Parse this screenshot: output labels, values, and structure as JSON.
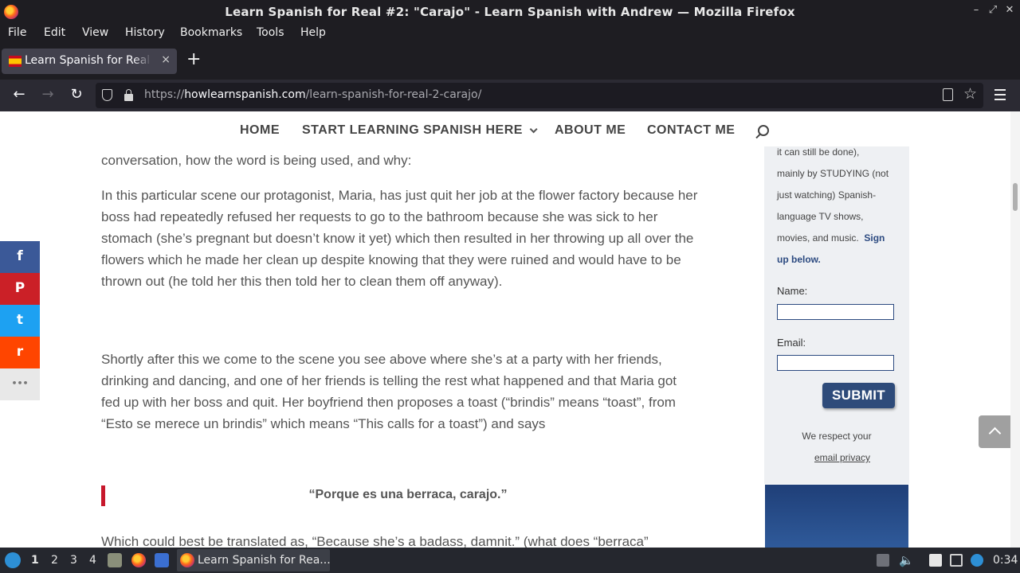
{
  "window": {
    "title": "Learn Spanish for Real #2: \"Carajo\" - Learn Spanish with Andrew — Mozilla Firefox"
  },
  "menu": [
    "File",
    "Edit",
    "View",
    "History",
    "Bookmarks",
    "Tools",
    "Help"
  ],
  "tab": {
    "title": "Learn Spanish for Real #2: \"Carajo\"",
    "close": "×",
    "new": "+"
  },
  "nav": {
    "url_prefix": "https://",
    "url_domain": "howlearnspanish.com",
    "url_path": "/learn-spanish-for-real-2-carajo/"
  },
  "site_nav": {
    "home": "HOME",
    "start": "START LEARNING SPANISH HERE",
    "about": "ABOUT ME",
    "contact": "CONTACT ME"
  },
  "article": {
    "p0": "conversation, how the word is being used, and why:",
    "p1": "In this particular scene our protagonist, Maria, has just quit her job at the flower factory because her boss had repeatedly refused her requests to go to the bathroom because she was sick to her stomach (she’s pregnant but doesn’t know it yet) which then resulted in her throwing up all over the flowers which he made her clean up despite knowing that they were ruined and would have to be thrown out (he told her this then told her to clean them off anyway).",
    "p2": "Shortly after this we come to the scene you see above where she’s at a party with her friends, drinking and dancing, and one of her friends is telling the rest what happened and that Maria got fed up with her boss and quit. Her boyfriend then proposes a toast (“brindis” means “toast”, from “Esto se merece un brindis” which means “This calls for a toast”) and says",
    "quote": "“Porque es una berraca, carajo.”",
    "p3": "Which could best be translated as, “Because she’s a badass, damnit.” (what does “berraca”"
  },
  "optin": {
    "intro_top": "it can still be done),",
    "intro_body": "mainly by STUDYING (not just watching) Spanish-language TV shows, movies, and music.",
    "intro_strong": "Sign up below.",
    "name_label": "Name:",
    "email_label": "Email:",
    "submit": "SUBMIT",
    "privacy_line1": "We respect your",
    "privacy_line2": "email privacy"
  },
  "share": {
    "facebook": "f",
    "pinterest": "P",
    "twitter": "t",
    "reddit": "r",
    "more": "•••"
  },
  "share_colors": {
    "facebook": "#3b5998",
    "pinterest": "#cb2027",
    "twitter": "#1da1f2",
    "reddit": "#ff4500",
    "more": "#e8e8e8"
  },
  "taskbar": {
    "workspaces": [
      "1",
      "2",
      "3",
      "4"
    ],
    "task_title": "Learn Spanish for Rea...",
    "clock": "0:34"
  }
}
